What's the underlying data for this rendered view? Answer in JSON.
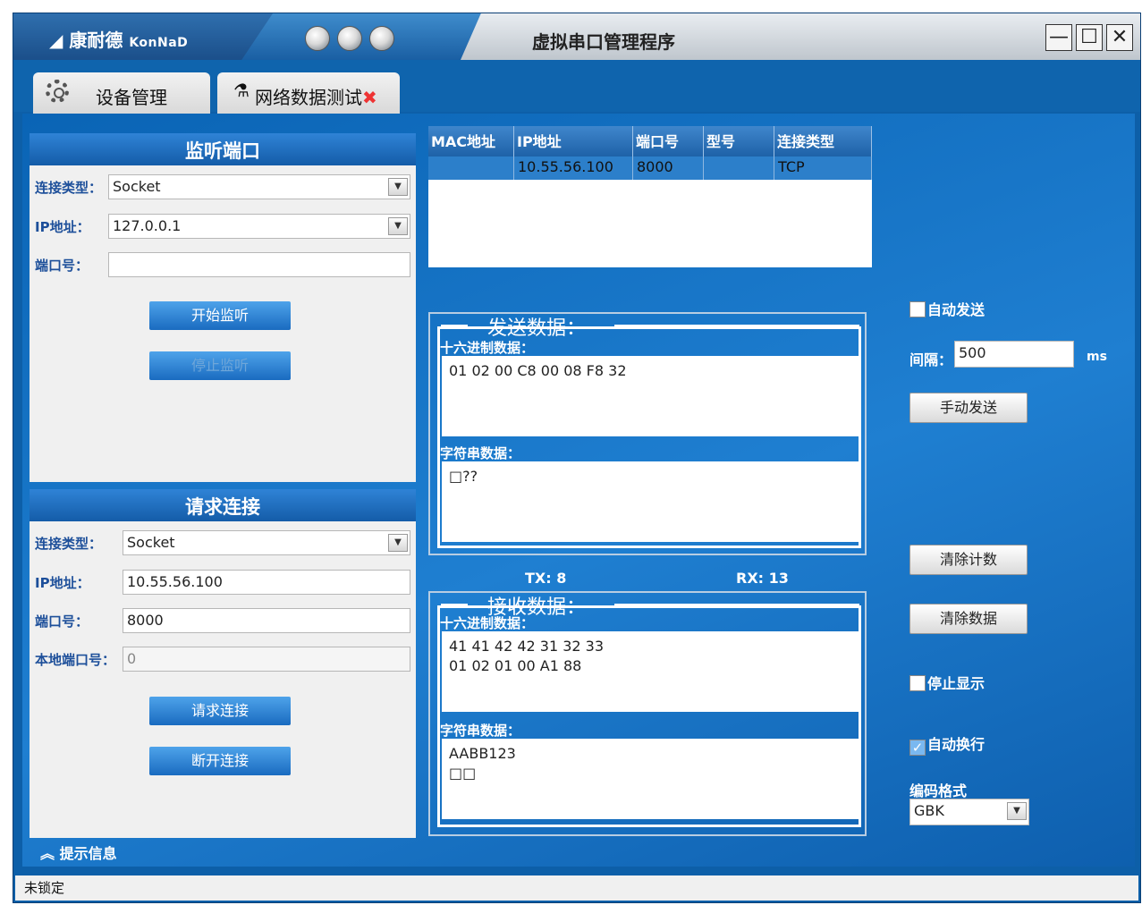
{
  "window": {
    "brand_cn": "康耐德",
    "brand_en": "KonNaD",
    "title": "虚拟串口管理程序",
    "btn_min": "—",
    "btn_max": "☐",
    "btn_close": "✕"
  },
  "tabs": [
    {
      "label": "设备管理"
    },
    {
      "label": "网络数据测试",
      "close": "✖"
    }
  ],
  "listen": {
    "header": "监听端口",
    "conn_type_label": "连接类型：",
    "conn_type_value": "Socket",
    "ip_label": "IP地址：",
    "ip_value": "127.0.0.1",
    "port_label": "端口号：",
    "port_value": "",
    "start_btn": "开始监听",
    "stop_btn": "停止监听"
  },
  "request": {
    "header": "请求连接",
    "conn_type_label": "连接类型：",
    "conn_type_value": "Socket",
    "ip_label": "IP地址：",
    "ip_value": "10.55.56.100",
    "port_label": "端口号：",
    "port_value": "8000",
    "local_port_label": "本地端口号：",
    "local_port_value": "0",
    "connect_btn": "请求连接",
    "disconnect_btn": "断开连接"
  },
  "table": {
    "columns": [
      "MAC地址",
      "IP地址",
      "端口号",
      "型号",
      "连接类型"
    ],
    "rows": [
      [
        "",
        "10.55.56.100",
        "8000",
        "",
        "TCP"
      ]
    ]
  },
  "send": {
    "title": "发送数据：",
    "hex_label": "十六进制数据：",
    "hex_value": "01 02 00 C8 00 08 F8 32",
    "str_label": "字符串数据：",
    "str_value": "□??"
  },
  "counters": {
    "tx": "TX: 8",
    "rx": "RX: 13"
  },
  "receive": {
    "title": "接收数据：",
    "hex_label": "十六进制数据：",
    "hex_line1": "41 41 42 42 31 32 33",
    "hex_line2": "01 02 01 00 A1 88",
    "str_label": "字符串数据：",
    "str_line1": "AABB123",
    "str_line2": "□□"
  },
  "right": {
    "auto_send": "自动发送",
    "interval_label": "间隔：",
    "interval_value": "500",
    "interval_unit": "ms",
    "manual_send": "手动发送",
    "clear_count": "清除计数",
    "clear_data": "清除数据",
    "stop_display": "停止显示",
    "auto_wrap": "自动换行",
    "encoding_label": "编码格式",
    "encoding_value": "GBK"
  },
  "tips": "提示信息",
  "status": "未锁定"
}
